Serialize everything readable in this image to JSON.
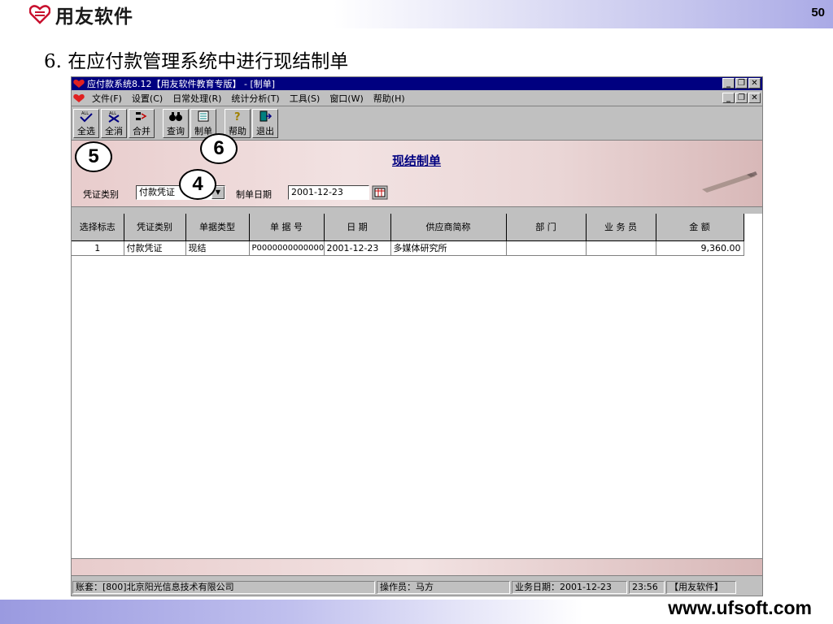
{
  "slide": {
    "brand": "用友软件",
    "page_number": "50",
    "title": "6.  在应付款管理系统中进行现结制单",
    "footer_url": "www.ufsoft.com",
    "callouts": [
      "5",
      "6",
      "4"
    ]
  },
  "window": {
    "title": "应付款系统8.12【用友软件教育专版】 - [制单]",
    "controls": [
      "_",
      "🗗",
      "×"
    ]
  },
  "menu": {
    "items": [
      "文件(F)",
      "设置(C)",
      "日常处理(R)",
      "统计分析(T)",
      "工具(S)",
      "窗口(W)",
      "帮助(H)"
    ]
  },
  "toolbar": {
    "buttons": [
      {
        "label": "全选",
        "icon": "select-all-icon"
      },
      {
        "label": "全消",
        "icon": "deselect-all-icon"
      },
      {
        "label": "合并",
        "icon": "merge-icon"
      },
      {
        "label": "查询",
        "icon": "binoculars-icon"
      },
      {
        "label": "制单",
        "icon": "make-voucher-icon"
      },
      {
        "label": "帮助",
        "icon": "help-icon"
      },
      {
        "label": "退出",
        "icon": "exit-icon"
      }
    ]
  },
  "panel": {
    "title": "现结制单",
    "voucher_type_label": "凭证类别",
    "voucher_type_value": "付款凭证",
    "date_label": "制单日期",
    "date_value": "2001-12-23"
  },
  "grid": {
    "columns": [
      "选择标志",
      "凭证类别",
      "单据类型",
      "单 据 号",
      "日    期",
      "供应商简称",
      "部    门",
      "业 务 员",
      "金    额"
    ],
    "rows": [
      [
        "1",
        "付款凭证",
        "现结",
        "P0000000000000",
        "2001-12-23",
        "多媒体研究所",
        "",
        "",
        "9,360.00"
      ]
    ]
  },
  "status": {
    "account": "账套：[800]北京阳光信息技术有限公司",
    "operator": "操作员：马方",
    "business_date": "业务日期：2001-12-23",
    "time": "23:56",
    "brand": "【用友软件】"
  }
}
